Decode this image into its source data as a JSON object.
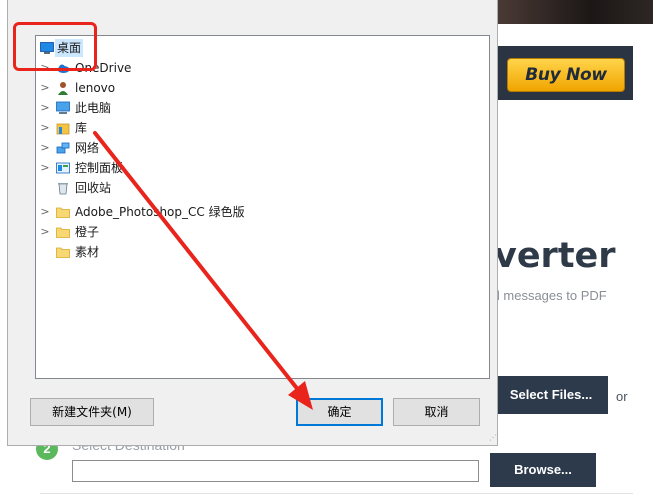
{
  "background": {
    "buy_now_label": "Buy Now",
    "heading_fragment": "verter",
    "subheading_fragment": "il messages to PDF",
    "select_files_label": "Select Files...",
    "or_text": "or",
    "step_number": "2",
    "step_label": "Select Destination",
    "destination_value": "",
    "browse_label": "Browse..."
  },
  "dialog": {
    "tree": [
      {
        "label": "桌面",
        "icon": "desktop-icon",
        "expandable": false,
        "selected": true
      },
      {
        "label": "OneDrive",
        "icon": "cloud-icon",
        "expandable": true,
        "selected": false
      },
      {
        "label": "lenovo",
        "icon": "user-icon",
        "expandable": true,
        "selected": false
      },
      {
        "label": "此电脑",
        "icon": "computer-icon",
        "expandable": true,
        "selected": false
      },
      {
        "label": "库",
        "icon": "library-icon",
        "expandable": true,
        "selected": false
      },
      {
        "label": "网络",
        "icon": "network-icon",
        "expandable": true,
        "selected": false
      },
      {
        "label": "控制面板",
        "icon": "control-panel-icon",
        "expandable": true,
        "selected": false
      },
      {
        "label": "回收站",
        "icon": "recycle-bin-icon",
        "expandable": false,
        "selected": false
      },
      {
        "label": "Adobe_Photoshop_CC  绿色版",
        "icon": "folder-icon",
        "expandable": true,
        "selected": false
      },
      {
        "label": "橙子",
        "icon": "folder-icon",
        "expandable": true,
        "selected": false
      },
      {
        "label": "素材",
        "icon": "folder-icon",
        "expandable": false,
        "selected": false
      }
    ],
    "new_folder_label": "新建文件夹(M)",
    "ok_label": "确定",
    "cancel_label": "取消"
  },
  "colors": {
    "annotation_red": "#e8241c",
    "selection_blue": "#cce8ff",
    "default_button_border": "#0078d7",
    "brand_dark": "#2d3a4b",
    "buy_now_orange": "#f0a500"
  }
}
